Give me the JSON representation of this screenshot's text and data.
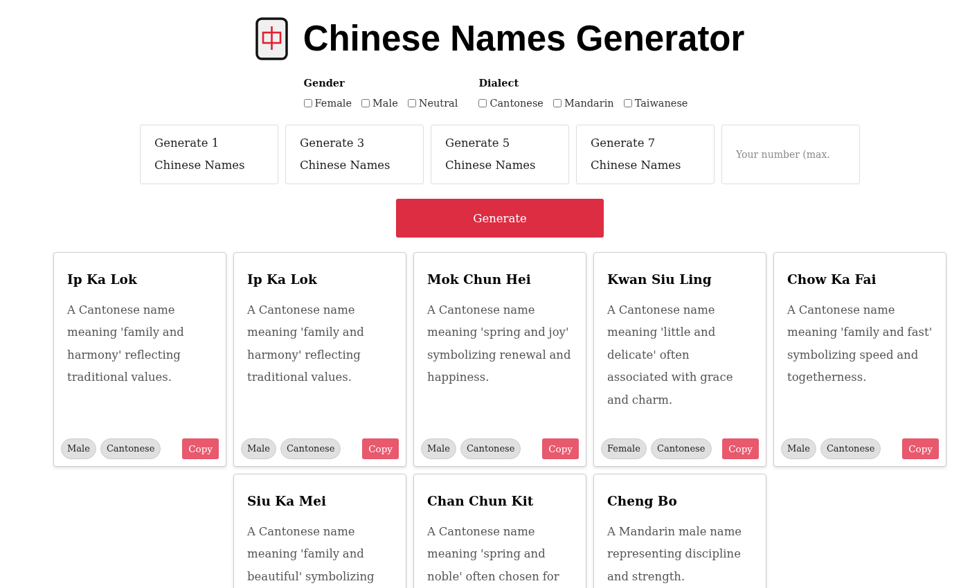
{
  "header": {
    "title": "Chinese Names Generator"
  },
  "filters": [
    {
      "label": "Gender",
      "options": [
        {
          "label": "Female",
          "checked": false
        },
        {
          "label": "Male",
          "checked": false
        },
        {
          "label": "Neutral",
          "checked": false
        }
      ]
    },
    {
      "label": "Dialect",
      "options": [
        {
          "label": "Cantonese",
          "checked": false
        },
        {
          "label": "Mandarin",
          "checked": false
        },
        {
          "label": "Taiwanese",
          "checked": false
        }
      ]
    }
  ],
  "quick_buttons": [
    "Generate 1 Chinese Names",
    "Generate 3 Chinese Names",
    "Generate 5 Chinese Names",
    "Generate 7 Chinese Names"
  ],
  "number_input": {
    "placeholder": "Your number (max."
  },
  "generate_button": "Generate",
  "cards": [
    {
      "name": "Ip Ka Lok",
      "description": "A Cantonese name meaning 'family and harmony' reflecting traditional values.",
      "tags": [
        "Male",
        "Cantonese"
      ],
      "copy": "Copy"
    },
    {
      "name": "Ip Ka Lok",
      "description": "A Cantonese name meaning 'family and harmony' reflecting traditional values.",
      "tags": [
        "Male",
        "Cantonese"
      ],
      "copy": "Copy"
    },
    {
      "name": "Mok Chun Hei",
      "description": "A Cantonese name meaning 'spring and joy' symbolizing renewal and happiness.",
      "tags": [
        "Male",
        "Cantonese"
      ],
      "copy": "Copy"
    },
    {
      "name": "Kwan Siu Ling",
      "description": "A Cantonese name meaning 'little and delicate' often associated with grace and charm.",
      "tags": [
        "Female",
        "Cantonese"
      ],
      "copy": "Copy"
    },
    {
      "name": "Chow Ka Fai",
      "description": "A Cantonese name meaning 'family and fast' symbolizing speed and togetherness.",
      "tags": [
        "Male",
        "Cantonese"
      ],
      "copy": "Copy"
    },
    {
      "name": "Siu Ka Mei",
      "description": "A Cantonese name meaning 'family and beautiful' symbolizing"
    },
    {
      "name": "Chan Chun Kit",
      "description": "A Cantonese name meaning 'spring and noble' often chosen for"
    },
    {
      "name": "Cheng Bo",
      "description": "A Mandarin male name representing discipline and strength."
    }
  ]
}
